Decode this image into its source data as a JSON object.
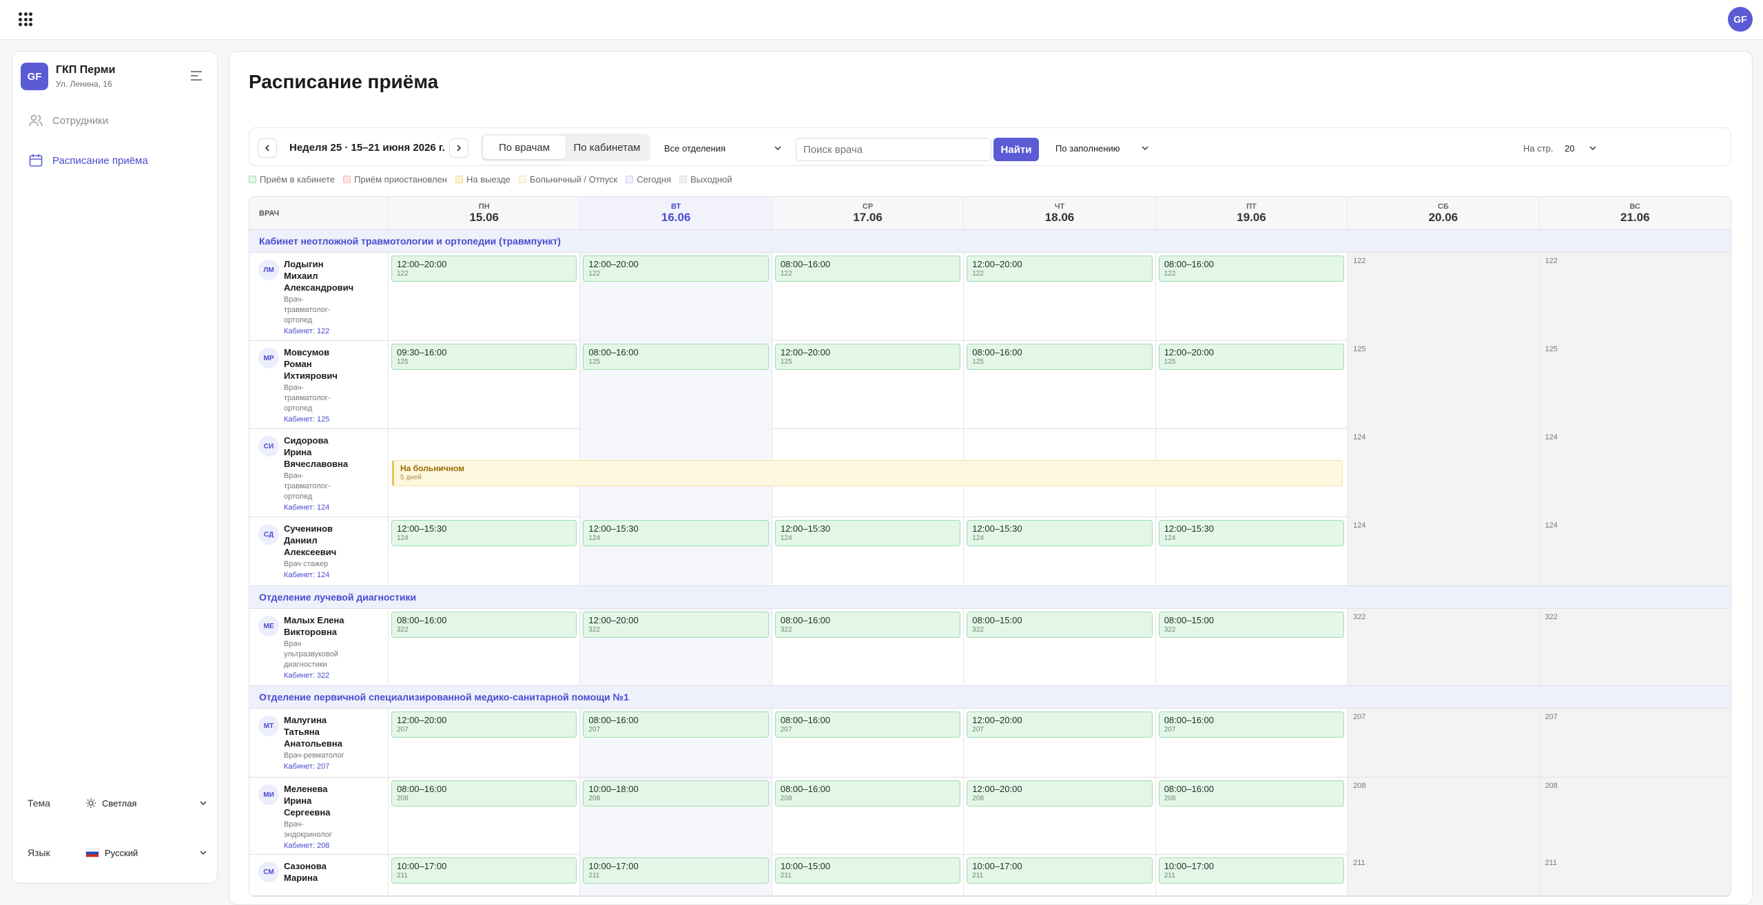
{
  "user": {
    "initials": "GF"
  },
  "org": {
    "initials": "GF",
    "name": "ГКП Перми",
    "address": "Ул. Ленина, 16"
  },
  "nav": [
    {
      "label": "Сотрудники",
      "icon": "users-icon",
      "active": false
    },
    {
      "label": "Расписание приёма",
      "icon": "calendar-icon",
      "active": true
    }
  ],
  "settings": {
    "theme_label": "Тема",
    "theme_value": "Светлая",
    "language_label": "Язык",
    "language_value": "Русский"
  },
  "page": {
    "title": "Расписание приёма"
  },
  "toolbar": {
    "week_label": "Неделя 25 · 15–21 июня 2026 г.",
    "view_by_doctors": "По врачам",
    "view_by_rooms": "По кабинетам",
    "department": "Все отделения",
    "search_placeholder": "Поиск врача",
    "search_button": "Найти",
    "sort": "По заполнению",
    "per_page_label": "На стр.",
    "per_page": "20"
  },
  "legend": [
    {
      "label": "Приём в кабинете",
      "color": "#e3f6e7",
      "border": "#9fdcaf"
    },
    {
      "label": "Приём приостановлен",
      "color": "#fde4e4",
      "border": "#f0b5b5"
    },
    {
      "label": "На выезде",
      "color": "#fdf3d6",
      "border": "#f0d98a"
    },
    {
      "label": "Больничный / Отпуск",
      "color": "#fdf9e8",
      "border": "#f2e8b8"
    },
    {
      "label": "Сегодня",
      "color": "#eef0fb",
      "border": "#c9cdf0"
    },
    {
      "label": "Выходной",
      "color": "#f0f0f2",
      "border": "#dcdce0"
    }
  ],
  "table": {
    "doctor_header": "ВРАЧ",
    "days": [
      {
        "name": "ПН",
        "date": "15.06",
        "today": false,
        "weekend": false
      },
      {
        "name": "ВТ",
        "date": "16.06",
        "today": true,
        "weekend": false
      },
      {
        "name": "СР",
        "date": "17.06",
        "today": false,
        "weekend": false
      },
      {
        "name": "ЧТ",
        "date": "18.06",
        "today": false,
        "weekend": false
      },
      {
        "name": "ПТ",
        "date": "19.06",
        "today": false,
        "weekend": false
      },
      {
        "name": "СБ",
        "date": "20.06",
        "today": false,
        "weekend": true
      },
      {
        "name": "ВС",
        "date": "21.06",
        "today": false,
        "weekend": true
      }
    ],
    "departments": [
      {
        "name": "Кабинет неотложной травмотологии и ортопедии (травмпункт)",
        "doctors": [
          {
            "initials": "ЛМ",
            "name": [
              "Лодыгин",
              "Михаил",
              "Александрович"
            ],
            "role": [
              "Врач-",
              "травматолог-",
              "ортопед"
            ],
            "room": "Кабинет: 122",
            "room_no": "122",
            "shifts": [
              "12:00–20:00",
              "12:00–20:00",
              "08:00–16:00",
              "12:00–20:00",
              "08:00–16:00"
            ]
          },
          {
            "initials": "МР",
            "name": [
              "Мовсумов",
              "Роман",
              "Ихтиярович"
            ],
            "role": [
              "Врач-",
              "травматолог-",
              "ортопед"
            ],
            "room": "Кабинет: 125",
            "room_no": "125",
            "shifts": [
              "09:30–16:00",
              "08:00–16:00",
              "12:00–20:00",
              "08:00–16:00",
              "12:00–20:00"
            ]
          },
          {
            "initials": "СИ",
            "name": [
              "Сидорова",
              "Ирина",
              "Вячеславовна"
            ],
            "role": [
              "Врач-",
              "травматолог-",
              "ортопед"
            ],
            "room": "Кабинет: 124",
            "room_no": "124",
            "sick": {
              "title": "На больничном",
              "duration": "5 дней"
            }
          },
          {
            "initials": "СД",
            "name": [
              "Сученинов",
              "Даниил",
              "Алексеевич"
            ],
            "role": [
              "Врач стажер"
            ],
            "room": "Кабинет: 124",
            "room_no": "124",
            "shifts": [
              "12:00–15:30",
              "12:00–15:30",
              "12:00–15:30",
              "12:00–15:30",
              "12:00–15:30"
            ]
          }
        ]
      },
      {
        "name": "Отделение лучевой диагностики",
        "doctors": [
          {
            "initials": "МЕ",
            "name": [
              "Малых Елена",
              "Викторовна"
            ],
            "role": [
              "Врач",
              "ультразвуковой",
              "диагностики"
            ],
            "room": "Кабинет: 322",
            "room_no": "322",
            "shifts": [
              "08:00–16:00",
              "12:00–20:00",
              "08:00–16:00",
              "08:00–15:00",
              "08:00–15:00"
            ]
          }
        ]
      },
      {
        "name": "Отделение первичной специализированной медико-санитарной помощи №1",
        "doctors": [
          {
            "initials": "МТ",
            "name": [
              "Малугина",
              "Татьяна",
              "Анатольевна"
            ],
            "role": [
              "Врач-ревматолог"
            ],
            "room": "Кабинет: 207",
            "room_no": "207",
            "shifts": [
              "12:00–20:00",
              "08:00–16:00",
              "08:00–16:00",
              "12:00–20:00",
              "08:00–16:00"
            ]
          },
          {
            "initials": "МИ",
            "name": [
              "Меленева",
              "Ирина",
              "Сергеевна"
            ],
            "role": [
              "Врач-",
              "эндокринолог"
            ],
            "room": "Кабинет: 208",
            "room_no": "208",
            "shifts": [
              "08:00–16:00",
              "10:00–18:00",
              "08:00–16:00",
              "12:00–20:00",
              "08:00–16:00"
            ]
          },
          {
            "initials": "СМ",
            "name": [
              "Сазонова",
              "Марина"
            ],
            "role": [],
            "room": "",
            "room_no": "211",
            "shifts": [
              "10:00–17:00",
              "10:00–17:00",
              "10:00–15:00",
              "10:00–17:00",
              "10:00–17:00"
            ]
          }
        ]
      }
    ]
  }
}
